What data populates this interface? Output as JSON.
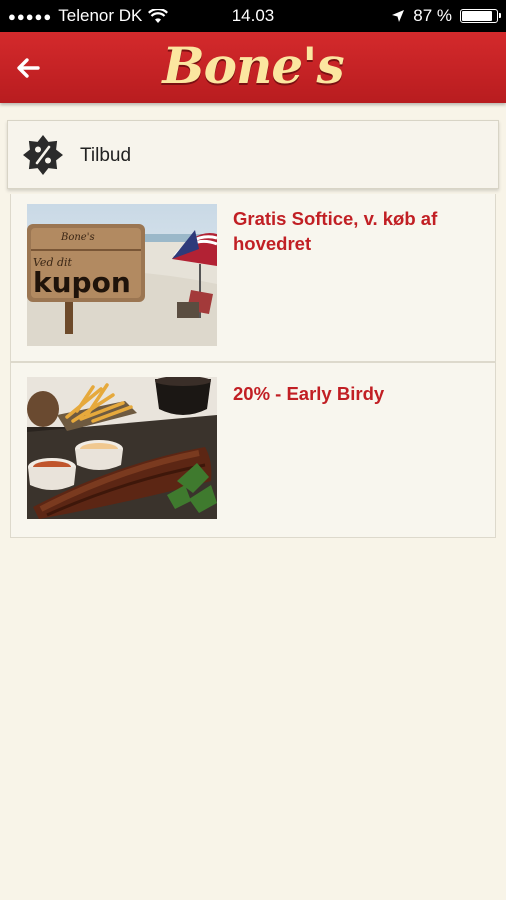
{
  "status_bar": {
    "carrier": "Telenor DK",
    "time": "14.03",
    "battery": "87 %",
    "battery_level": 0.87
  },
  "app_bar": {
    "logo": "Bone's"
  },
  "section": {
    "title": "Tilbud"
  },
  "offers": [
    {
      "title": "Gratis Softice, v. køb af hovedret",
      "sign_top": "Bone's",
      "sign_main": "kupon",
      "sign_small": "Ved dit"
    },
    {
      "title": "20% - Early Birdy"
    }
  ]
}
